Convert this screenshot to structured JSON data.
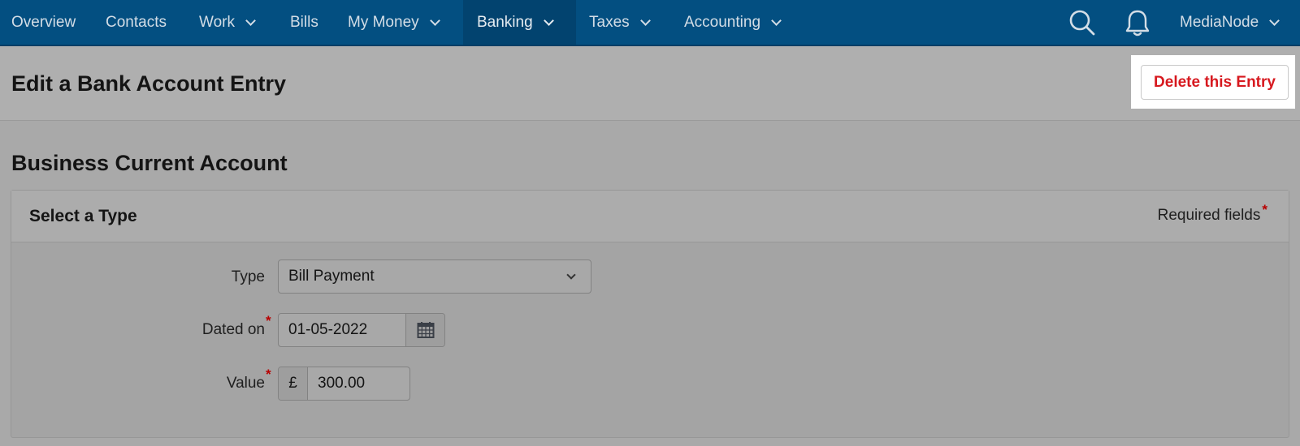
{
  "nav": {
    "items": [
      {
        "label": "Overview",
        "dropdown": false
      },
      {
        "label": "Contacts",
        "dropdown": false
      },
      {
        "label": "Work",
        "dropdown": true
      },
      {
        "label": "Bills",
        "dropdown": false
      },
      {
        "label": "My Money",
        "dropdown": true
      },
      {
        "label": "Banking",
        "dropdown": true,
        "active": true
      },
      {
        "label": "Taxes",
        "dropdown": true
      },
      {
        "label": "Accounting",
        "dropdown": true
      }
    ],
    "search_icon": "search-icon",
    "notification_icon": "bell-icon",
    "user_menu": "MediaNode"
  },
  "page": {
    "title": "Edit a Bank Account Entry",
    "delete_label": "Delete this Entry",
    "account_name": "Business Current Account"
  },
  "form": {
    "section_title": "Select a Type",
    "required_note": "Required fields",
    "required_mark": "*",
    "type_label": "Type",
    "type_value": "Bill Payment",
    "date_label": "Dated on",
    "date_value": "01-05-2022",
    "value_label": "Value",
    "currency_symbol": "£",
    "value_amount": "300.00"
  },
  "colors": {
    "nav_bg": "#034f81",
    "nav_active_bg": "#02436f",
    "delete_text": "#d7191f",
    "required_star": "#b80000"
  }
}
